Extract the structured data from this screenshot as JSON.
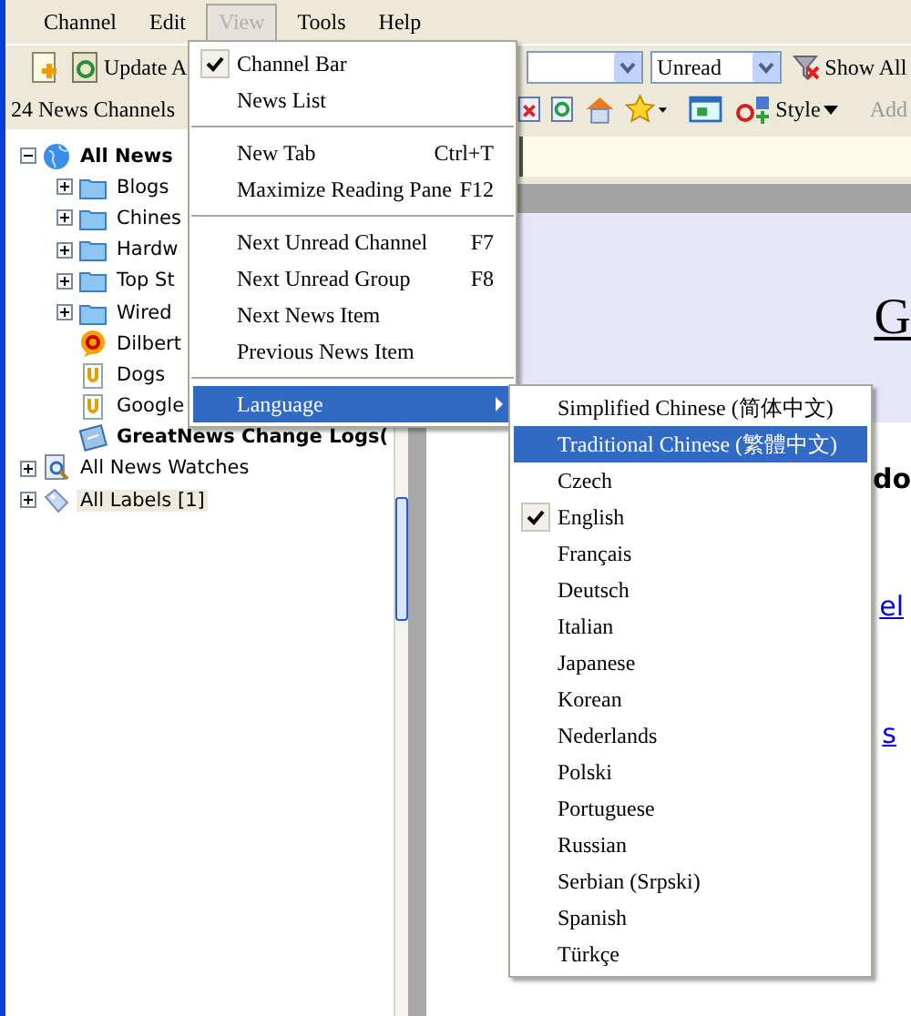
{
  "menubar": [
    {
      "label": "Channel",
      "selected": false
    },
    {
      "label": "Edit",
      "selected": false
    },
    {
      "label": "View",
      "selected": true
    },
    {
      "label": "Tools",
      "selected": false
    },
    {
      "label": "Help",
      "selected": false
    }
  ],
  "toolbar": {
    "update_label": "Update A",
    "filter_value": "Unread",
    "show_all": "Show All"
  },
  "channels_header": "24 News Channels",
  "tree": [
    {
      "label": "All News",
      "kind": "globe",
      "unread": true,
      "expanded": true,
      "selected": false,
      "children": [
        {
          "label": "Blogs",
          "kind": "folder",
          "unread": false,
          "expanded": false,
          "selected": false
        },
        {
          "label": "Chines",
          "kind": "folder",
          "unread": false,
          "expanded": false,
          "selected": false
        },
        {
          "label": "Hardw",
          "kind": "folder",
          "unread": false,
          "expanded": false,
          "selected": false
        },
        {
          "label": "Top St",
          "kind": "folder",
          "unread": false,
          "expanded": false,
          "selected": false
        },
        {
          "label": "Wired",
          "kind": "folder",
          "unread": false,
          "expanded": false,
          "selected": false
        },
        {
          "label": "Dilbert",
          "kind": "comic",
          "unread": false,
          "selected": false
        },
        {
          "label": "Dogs",
          "kind": "feed",
          "unread": false,
          "selected": false
        },
        {
          "label": "Google",
          "kind": "feed",
          "unread": false,
          "selected": false
        },
        {
          "label": "GreatNews Change Logs(",
          "kind": "log",
          "unread": true,
          "selected": false
        }
      ]
    },
    {
      "label": "All News Watches",
      "kind": "watch",
      "unread": false,
      "expanded": false,
      "selected": false
    },
    {
      "label": "All Labels [1]",
      "kind": "label",
      "unread": false,
      "expanded": false,
      "selected": true
    }
  ],
  "reader_toolbar": {
    "style_label": "Style",
    "add_label": "Add"
  },
  "article": {
    "heading": "G",
    "bold_text": "do",
    "links": [
      "el",
      "s"
    ]
  },
  "view_menu": [
    {
      "kind": "item",
      "label": "Channel Bar",
      "checked": true,
      "selected": false
    },
    {
      "kind": "item",
      "label": "News List",
      "checked": false,
      "selected": false
    },
    {
      "kind": "separator"
    },
    {
      "kind": "item",
      "label": "New Tab",
      "shortcut": "Ctrl+T",
      "checked": false,
      "selected": false
    },
    {
      "kind": "item",
      "label": "Maximize Reading Pane",
      "shortcut": "F12",
      "checked": false,
      "selected": false
    },
    {
      "kind": "separator"
    },
    {
      "kind": "item",
      "label": "Next Unread Channel",
      "shortcut": "F7",
      "checked": false,
      "selected": false
    },
    {
      "kind": "item",
      "label": "Next Unread Group",
      "shortcut": "F8",
      "checked": false,
      "selected": false
    },
    {
      "kind": "item",
      "label": "Next News Item",
      "checked": false,
      "selected": false
    },
    {
      "kind": "item",
      "label": "Previous News Item",
      "checked": false,
      "selected": false
    },
    {
      "kind": "separator"
    },
    {
      "kind": "submenu",
      "label": "Language",
      "checked": false,
      "selected": true
    }
  ],
  "language_menu": [
    {
      "label": "Simplified Chinese (简体中文)",
      "checked": false,
      "selected": false
    },
    {
      "label": "Traditional Chinese (繁體中文)",
      "checked": false,
      "selected": true
    },
    {
      "label": "Czech",
      "checked": false,
      "selected": false
    },
    {
      "label": "English",
      "checked": true,
      "selected": false
    },
    {
      "label": "Français",
      "checked": false,
      "selected": false
    },
    {
      "label": "Deutsch",
      "checked": false,
      "selected": false
    },
    {
      "label": "Italian",
      "checked": false,
      "selected": false
    },
    {
      "label": "Japanese",
      "checked": false,
      "selected": false
    },
    {
      "label": "Korean",
      "checked": false,
      "selected": false
    },
    {
      "label": "Nederlands",
      "checked": false,
      "selected": false
    },
    {
      "label": "Polski",
      "checked": false,
      "selected": false
    },
    {
      "label": "Portuguese",
      "checked": false,
      "selected": false
    },
    {
      "label": "Russian",
      "checked": false,
      "selected": false
    },
    {
      "label": "Serbian (Srpski)",
      "checked": false,
      "selected": false
    },
    {
      "label": "Spanish",
      "checked": false,
      "selected": false
    },
    {
      "label": "Türkçe",
      "checked": false,
      "selected": false
    }
  ]
}
